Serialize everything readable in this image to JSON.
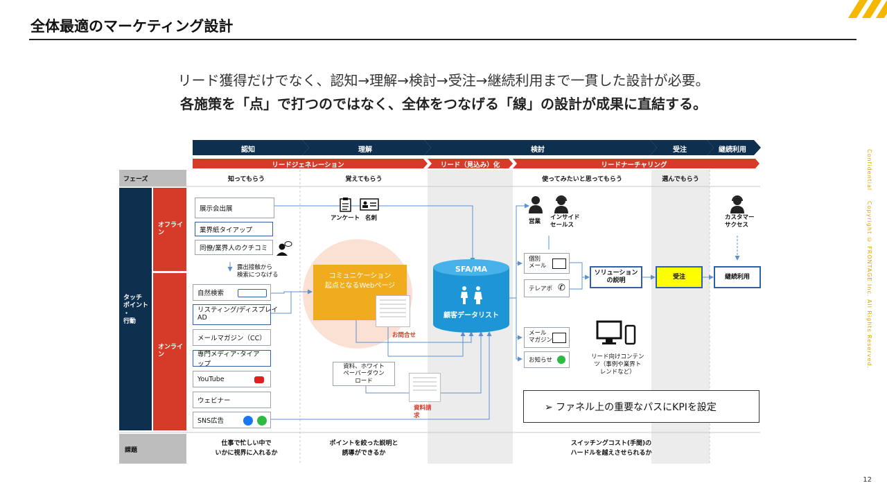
{
  "slide": {
    "title": "全体最適のマーケティング設計",
    "subtitle_line1": "リード獲得だけでなく、認知→理解→検討→受注→継続利用まで一貫した設計が必要。",
    "subtitle_line2": "各施策を「点」で打つのではなく、全体をつなげる「線」の設計が成果に直結する。",
    "confidential": "Confidential",
    "copyright": "Copyright © FRONTAGE Inc. All Rights Reserved.",
    "page_number": "12"
  },
  "colors": {
    "navy": "#0f2f4f",
    "red": "#d63b2a",
    "accent_yellow": "#f5b800",
    "blue": "#2e5fa8",
    "gray": "#bdbdbd"
  },
  "stages": [
    "認知",
    "理解",
    "検討",
    "受注",
    "継続利用"
  ],
  "stage_groups": [
    "リードジェネレーション",
    "リード（見込み）化",
    "リードナーチャリング"
  ],
  "phase_label": "フェーズ",
  "phases": [
    "知ってもらう",
    "覚えてもらう",
    "使ってみたいと思ってもらう",
    "選んでもらう"
  ],
  "row_labels": {
    "touchpoint": "タッチ\nポイント\n・\n行動",
    "offline": "オフライ\nン",
    "online": "オンライ\nン",
    "issue": "課題"
  },
  "offline_items": [
    "展示会出展",
    "業界紙タイアップ",
    "同僚/業界人のクチコミ"
  ],
  "online_items": [
    "自然検索",
    "リスティング/ディスプレイ\nAD",
    "メールマガジン（CC）",
    "専門メディア･タイアップ",
    "YouTube",
    "ウェビナー",
    "SNS広告"
  ],
  "exposure_note": "露出接触から\n検索につなげる",
  "survey_label": "アンケート",
  "card_label": "名刺",
  "web_page_label": "コミュニケーション\n起点となるWebページ",
  "inquiry_label": "お問合せ",
  "whitepaper_label": "資料、ホワイト\nペーパーダウン\nロード",
  "doc_request_label": "資料請\n求",
  "database": {
    "title": "SFA/MA",
    "label": "顧客データリスト"
  },
  "sales_label": "営業",
  "inside_sales_label": "インサイド\nセールス",
  "cs_label": "カスタマー\nサクセス",
  "channels": [
    "個別\nメール",
    "テレアポ",
    "メール\nマガジン",
    "お知らせ"
  ],
  "solution_label": "ソリューション\nの説明",
  "order_label": "受注",
  "continue_label": "継続利用",
  "lead_content_label": "リード向けコンテン\nツ（事例や業界ト\nレンドなど）",
  "kpi_note": "➢  ファネル上の重要なパスにKPIを設定",
  "issues": [
    "仕事で忙しい中で\nいかに視界に入れるか",
    "ポイントを絞った説明と\n誘導ができるか",
    "スイッチングコスト(手間)の\nハードルを越えさせられるか"
  ]
}
